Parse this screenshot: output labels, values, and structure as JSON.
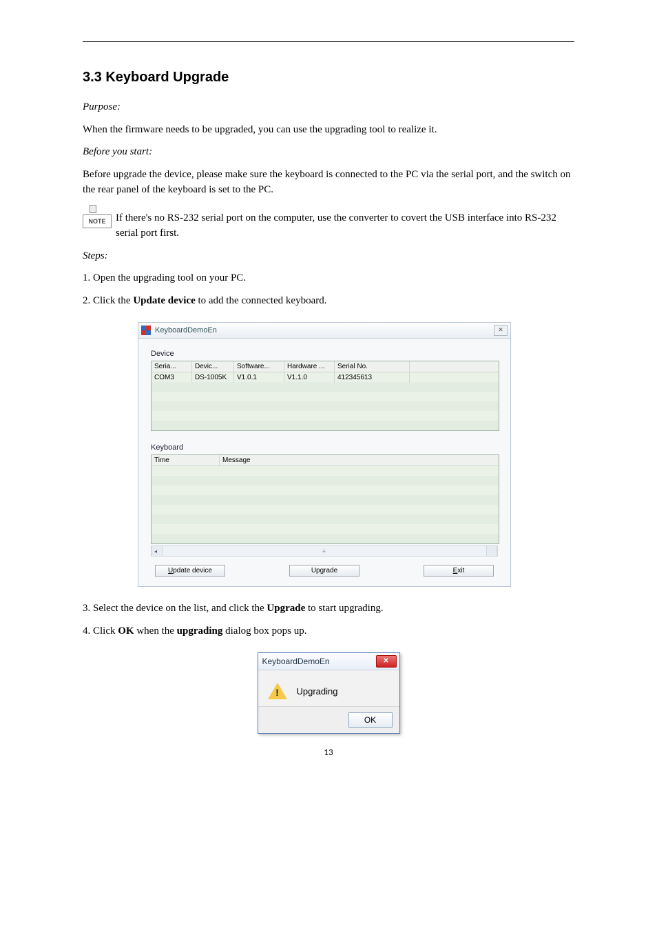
{
  "section_heading": "3.3 Keyboard Upgrade",
  "purpose_label": "Purpose:",
  "purpose_text": "When the firmware needs to be upgraded, you can use the upgrading tool to realize it.",
  "before_heading": "Before you start:",
  "before_text": "Before upgrade the device, please make sure the keyboard is connected to the PC via the serial port, and the switch on the rear panel of the keyboard is set to the PC.",
  "note_icon_label": "NOTE",
  "note_text": "If there's no RS-232 serial port on the computer, use the converter to covert the USB interface into RS-232 serial port first.",
  "steps_label": "Steps:",
  "step1": "Open the upgrading tool on your PC.",
  "step2_prefix": "Click the ",
  "step2_btn": "Update device",
  "step2_suffix": " to add the connected keyboard.",
  "step1_num": "1.",
  "step2_num": "2.",
  "app_window": {
    "title": "KeyboardDemoEn",
    "close_glyph": "✕",
    "device_label": "Device",
    "device_headers": [
      "Seria...",
      "Devic...",
      "Software...",
      "Hardware ...",
      "Serial No."
    ],
    "device_row": [
      "COM3",
      "DS-1005K",
      "V1.0.1",
      "V1.1.0",
      "412345613"
    ],
    "keyboard_label": "Keyboard",
    "keyboard_headers": [
      "Time",
      "Message"
    ],
    "buttons": {
      "update": {
        "mnemonic": "U",
        "rest": "pdate device"
      },
      "upgrade": {
        "pre": "Up",
        "mnemonic": "g",
        "rest": "rade"
      },
      "exit": {
        "mnemonic": "E",
        "rest": "xit"
      }
    },
    "scroll_left": "◂",
    "scroll_right": "▸",
    "scroll_mid": "≡"
  },
  "step3_num": "3.",
  "step3_prefix": "Select the device on the list, and click the ",
  "step3_btn": "Upgrade",
  "step3_suffix": " to start upgrading.",
  "step4_num": "4.",
  "step4_prefix": "Click ",
  "step4_btn": "OK",
  "step4_middle": " when the ",
  "step4_dialog_name": "upgrading",
  "step4_suffix": " dialog box pops up.",
  "dialog": {
    "title": "KeyboardDemoEn",
    "close_glyph": "✕",
    "bang": "!",
    "message": "Upgrading",
    "ok": "OK"
  },
  "page_number": "13"
}
